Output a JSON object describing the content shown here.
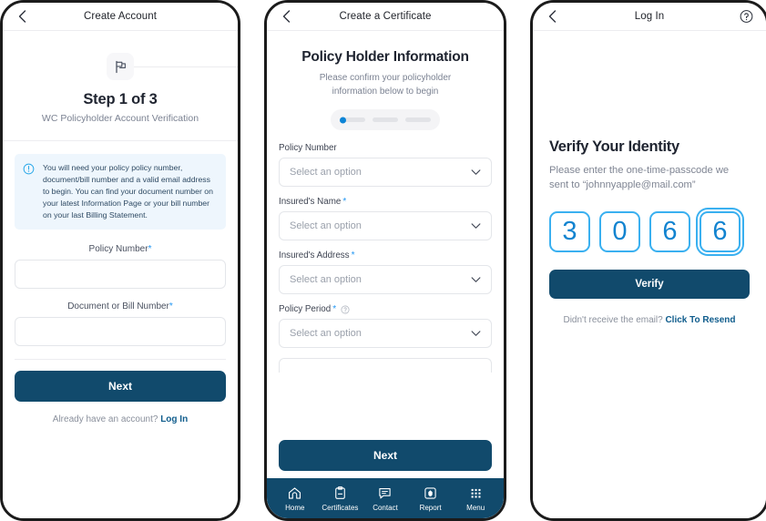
{
  "screen1": {
    "nav": {
      "title": "Create Account",
      "back_icon": "chevron-left-icon"
    },
    "step": {
      "icon": "flag-icon",
      "title": "Step 1 of 3",
      "subtitle": "WC Policyholder Account Verification"
    },
    "info": {
      "icon": "info-circle-icon",
      "text": "You will need your policy policy number, document/bill number and a valid email address to begin. You can find your document number on your latest Information Page or your bill number on your last Billing Statement."
    },
    "fields": [
      {
        "label": "Policy Number",
        "required": "*",
        "value": "",
        "placeholder": ""
      },
      {
        "label": "Document or Bill Number",
        "required": "*",
        "value": "",
        "placeholder": ""
      }
    ],
    "primary_button": "Next",
    "footer_text": "Already have an account?",
    "footer_link": "Log In"
  },
  "screen2": {
    "nav": {
      "title": "Create a Certificate",
      "back_icon": "chevron-left-icon"
    },
    "title": "Policy Holder Information",
    "subtitle_line1": "Please confirm your policyholder",
    "subtitle_line2": "information below to begin",
    "progress": {
      "total": 3,
      "active_index": 0
    },
    "fields": [
      {
        "label": "Policy Number",
        "required": "",
        "tooltip": false,
        "value": "Select an option"
      },
      {
        "label": "Insured's Name",
        "required": "*",
        "tooltip": false,
        "value": "Select an option"
      },
      {
        "label": "Insured's Address",
        "required": "*",
        "tooltip": false,
        "value": "Select an option"
      },
      {
        "label": "Policy Period",
        "required": "*",
        "tooltip": true,
        "value": "Select an option"
      }
    ],
    "primary_button": "Next",
    "tabs": [
      {
        "label": "Home",
        "icon": "home-icon"
      },
      {
        "label": "Certificates",
        "icon": "clipboard-icon"
      },
      {
        "label": "Contact",
        "icon": "chat-icon"
      },
      {
        "label": "Report",
        "icon": "shield-report-icon"
      },
      {
        "label": "Menu",
        "icon": "grid-menu-icon"
      }
    ]
  },
  "screen3": {
    "nav": {
      "title": "Log In",
      "back_icon": "chevron-left-icon",
      "help_icon": "question-circle-icon"
    },
    "title": "Verify Your Identity",
    "subtitle_line1": "Please enter the one-time-passcode we",
    "subtitle_line2": "sent to “johnnyapple@mail.com”",
    "otp": {
      "digits": [
        "3",
        "0",
        "6",
        "6"
      ],
      "focused_index": 3
    },
    "primary_button": "Verify",
    "footer_text": "Didn't receive the email?",
    "footer_link": "Click To Resend"
  },
  "colors": {
    "primary_navy": "#114a6c",
    "accent_blue": "#2196f3",
    "otp_blue": "#3ab0f0",
    "info_bg": "#eef6fd",
    "link": "#0f5c8c"
  }
}
